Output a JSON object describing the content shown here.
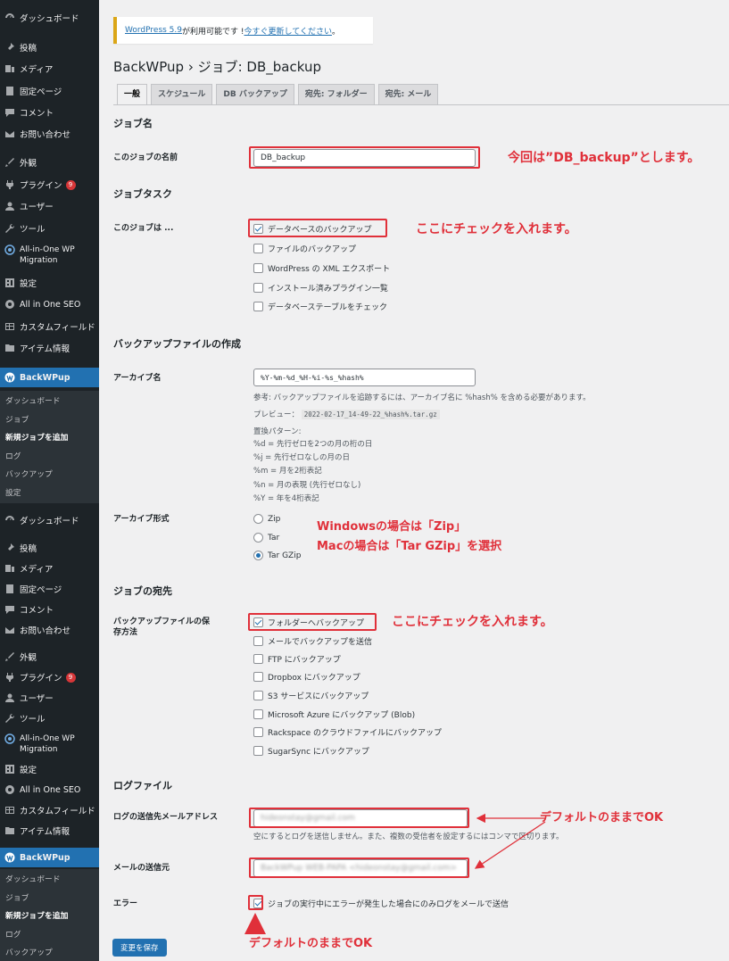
{
  "sidebar": {
    "top_items": [
      {
        "icon": "gauge-icon",
        "label": "ダッシュボード"
      },
      {
        "icon": "pin-icon",
        "label": "投稿"
      },
      {
        "icon": "media-icon",
        "label": "メディア"
      },
      {
        "icon": "page-icon",
        "label": "固定ページ"
      },
      {
        "icon": "comment-icon",
        "label": "コメント"
      },
      {
        "icon": "mail-icon",
        "label": "お問い合わせ"
      },
      {
        "icon": "brush-icon",
        "label": "外観"
      },
      {
        "icon": "plugin-icon",
        "label": "プラグイン",
        "badge": "9"
      },
      {
        "icon": "user-icon",
        "label": "ユーザー"
      },
      {
        "icon": "wrench-icon",
        "label": "ツール"
      },
      {
        "icon": "migration-icon",
        "label": "All-in-One WP Migration"
      },
      {
        "icon": "settings-icon",
        "label": "設定"
      },
      {
        "icon": "seo-icon",
        "label": "All in One SEO"
      },
      {
        "icon": "grid-icon",
        "label": "カスタムフィールド"
      },
      {
        "icon": "folder-icon",
        "label": "アイテム情報"
      },
      {
        "icon": "backwpup-icon",
        "label": "BackWPup"
      }
    ],
    "submenu": [
      "ダッシュボード",
      "ジョブ",
      "新規ジョブを追加",
      "ログ",
      "バックアップ",
      "設定"
    ],
    "second_items": [
      {
        "icon": "gauge-icon",
        "label": "ダッシュボード"
      },
      {
        "icon": "pin-icon",
        "label": "投稿"
      },
      {
        "icon": "media-icon",
        "label": "メディア"
      },
      {
        "icon": "page-icon",
        "label": "固定ページ"
      },
      {
        "icon": "comment-icon",
        "label": "コメント"
      },
      {
        "icon": "mail-icon",
        "label": "お問い合わせ"
      },
      {
        "icon": "brush-icon",
        "label": "外観"
      },
      {
        "icon": "plugin-icon",
        "label": "プラグイン",
        "badge": "9"
      },
      {
        "icon": "user-icon",
        "label": "ユーザー"
      },
      {
        "icon": "wrench-icon",
        "label": "ツール"
      },
      {
        "icon": "migration-icon",
        "label": "All-in-One WP Migration"
      },
      {
        "icon": "settings-icon",
        "label": "設定"
      },
      {
        "icon": "seo-icon",
        "label": "All in One SEO"
      },
      {
        "icon": "grid-icon",
        "label": "カスタムフィールド"
      },
      {
        "icon": "folder-icon",
        "label": "アイテム情報"
      },
      {
        "icon": "backwpup-icon",
        "label": "BackWPup"
      }
    ],
    "submenu2": [
      "ダッシュボード",
      "ジョブ",
      "新規ジョブを追加",
      "ログ",
      "バックアップ"
    ]
  },
  "notice": {
    "link1": "WordPress 5.9",
    "text": " が利用可能です ! ",
    "link2": "今すぐ更新してください",
    "end": "。"
  },
  "page_title": "BackWPup › ジョブ: DB_backup",
  "tabs": [
    "一般",
    "スケジュール",
    "DB バックアップ",
    "宛先: フォルダー",
    "宛先: メール"
  ],
  "job_name": {
    "heading": "ジョブ名",
    "label": "このジョブの名前",
    "value": "DB_backup"
  },
  "job_tasks": {
    "heading": "ジョブタスク",
    "label": "このジョブは ...",
    "options": [
      {
        "label": "データベースのバックアップ",
        "checked": true
      },
      {
        "label": "ファイルのバックアップ",
        "checked": false
      },
      {
        "label": "WordPress の XML エクスポート",
        "checked": false
      },
      {
        "label": "インストール済みプラグイン一覧",
        "checked": false
      },
      {
        "label": "データベーステーブルをチェック",
        "checked": false
      }
    ]
  },
  "archive": {
    "heading": "バックアップファイルの作成",
    "name_label": "アーカイブ名",
    "name_value": "%Y-%m-%d_%H-%i-%s_%hash%",
    "hint": "参考: バックアップファイルを追跡するには、アーカイブ名に %hash% を含める必要があります。",
    "preview_label": "プレビュー：",
    "preview_value": "2022-02-17_14-49-22_%hash%.tar.gz",
    "patterns_title": "置換パターン:",
    "patterns": [
      "%d = 先行ゼロを2つの月の桁の日",
      "%j = 先行ゼロなしの月の日",
      "%m = 月を2桁表記",
      "%n = 月の表現 (先行ゼロなし)",
      "%Y = 年を4桁表記"
    ],
    "format_label": "アーカイブ形式",
    "formats": [
      {
        "label": "Zip",
        "checked": false
      },
      {
        "label": "Tar",
        "checked": false
      },
      {
        "label": "Tar GZip",
        "checked": true
      }
    ]
  },
  "destination": {
    "heading": "ジョブの宛先",
    "label": "バックアップファイルの保存方法",
    "options": [
      {
        "label": "フォルダーへバックアップ",
        "checked": true
      },
      {
        "label": "メールでバックアップを送信",
        "checked": false
      },
      {
        "label": "FTP にバックアップ",
        "checked": false
      },
      {
        "label": "Dropbox にバックアップ",
        "checked": false
      },
      {
        "label": "S3 サービスにバックアップ",
        "checked": false
      },
      {
        "label": "Microsoft Azure にバックアップ (Blob)",
        "checked": false
      },
      {
        "label": "Rackspace のクラウドファイルにバックアップ",
        "checked": false
      },
      {
        "label": "SugarSync にバックアップ",
        "checked": false
      }
    ]
  },
  "log": {
    "heading": "ログファイル",
    "email_label": "ログの送信先メールアドレス",
    "email_value": "hideonstay@gmail.com",
    "email_hint": "空にするとログを送信しません。また、複数の受信者を設定するにはコンマで区切ります。",
    "from_label": "メールの送信元",
    "from_value": "BackWPup WEB-PAPA <hideonstay@gmail.com>",
    "error_label": "エラー",
    "error_option": "ジョブの実行中にエラーが発生した場合にのみログをメールで送信",
    "error_checked": true
  },
  "save_button": "変更を保存",
  "annotations": {
    "job_name": "今回は”DB_backup”とします。",
    "db_check": "ここにチェックを入れます。",
    "format1": "Windowsの場合は「Zip」",
    "format2": "Macの場合は「Tar GZip」を選択",
    "folder_check": "ここにチェックを入れます。",
    "default1": "デフォルトのままでOK",
    "default2": "デフォルトのままでOK"
  },
  "colors": {
    "accent": "#2271b1",
    "annotation": "#e0303a",
    "sidebar": "#1d2327"
  }
}
